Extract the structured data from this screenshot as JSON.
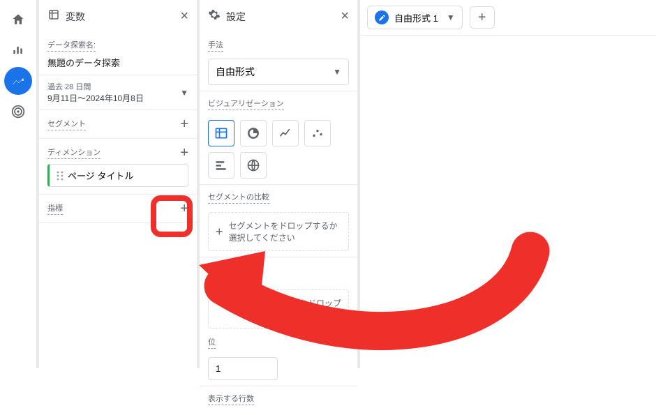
{
  "annotation": {
    "color": "#ee2f2a"
  },
  "variables": {
    "title": "変数",
    "name_label": "データ探索名:",
    "name_value": "無題のデータ探索",
    "date_range_label": "過去 28 日間",
    "date_range_value": "9月11日～2024年10月8日",
    "segments_label": "セグメント",
    "dimensions_label": "ディメンション",
    "dimension_chip": "ページ タイトル",
    "metrics_label": "指標"
  },
  "settings": {
    "title": "設定",
    "method_label": "手法",
    "method_value": "自由形式",
    "viz_label": "ビジュアリゼーション",
    "seg_compare_label": "セグメントの比較",
    "seg_drop_text": "セグメントをドロップするか選択してください",
    "rows_dropzone_partial": "ションをドロップ\nしてください",
    "rows_label_partial": "位",
    "rows_value": "1",
    "show_rows_label": "表示する行数"
  },
  "tabs": {
    "tab1_label": "自由形式 1"
  },
  "icons": {
    "home": "home-icon",
    "bar": "bar-chart-icon",
    "explore": "explore-icon",
    "target": "target-icon",
    "variables": "data-icon",
    "gear": "gear-icon",
    "table": "table-icon",
    "donut": "donut-icon",
    "line": "line-icon",
    "scatter": "scatter-icon",
    "bar_h": "bar-horizontal-icon",
    "globe": "globe-icon",
    "pencil": "pencil-icon",
    "drag": "drag-handle-icon"
  }
}
